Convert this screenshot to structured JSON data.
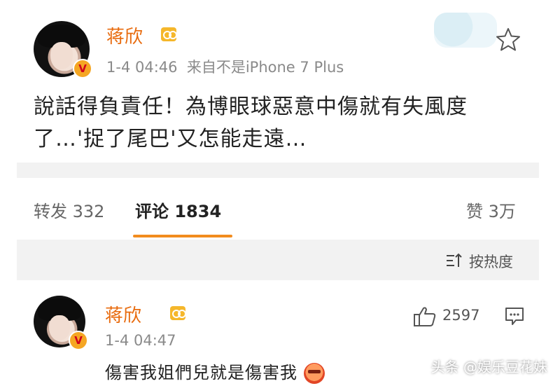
{
  "post": {
    "username": "蒋欣",
    "meta": "1-4 04:46  来自不是iPhone 7 Plus",
    "text_line1": "說話得負責任！為博眼球惡意中傷就有失風度",
    "text_line2": "了…'捉了尾巴'又怎能走遠…"
  },
  "tabs": {
    "repost": "转发 332",
    "comment": "评论 1834",
    "like": "赞 3万"
  },
  "sort": {
    "label": "按热度"
  },
  "comment": {
    "username": "蒋欣",
    "meta": "1-4 04:47",
    "likes": "2597",
    "text": "傷害我姐們兒就是傷害我"
  },
  "watermark": {
    "text": "头条 @娱乐豆花妹"
  },
  "icons": {
    "star": "star-icon",
    "verified": "verified-badge-icon",
    "vip": "vip-icon",
    "thumbs_up": "thumbs-up-icon",
    "reply": "comment-icon",
    "sort": "sort-icon",
    "emoji": "angry-emoji-icon"
  },
  "colors": {
    "username": "#e86b0e",
    "tab_underline": "#f28c1e",
    "divider": "#f2f2f2"
  }
}
